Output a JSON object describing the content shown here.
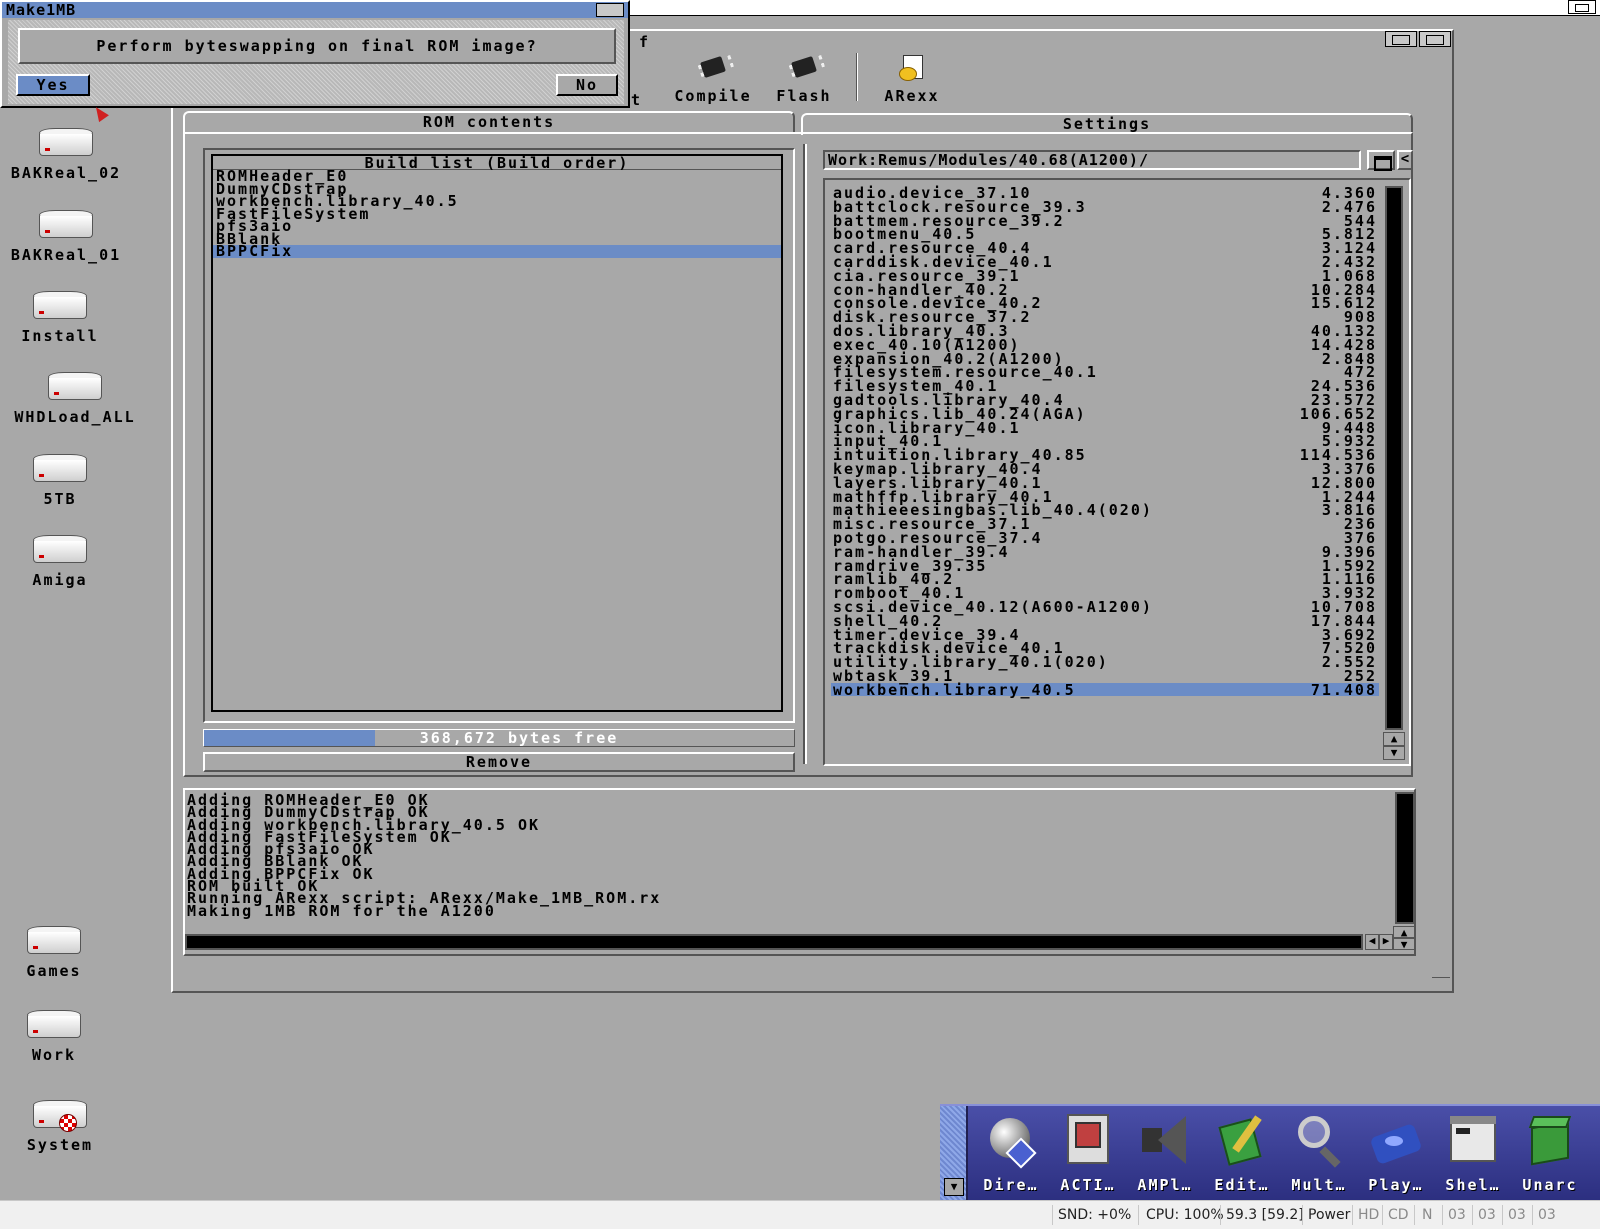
{
  "requester": {
    "title": "Make1MB",
    "message": "Perform byteswapping on final ROM image?",
    "yes_label": "Yes",
    "no_label": "No"
  },
  "desktop": {
    "icons": [
      {
        "label": "BAKReal_02",
        "icon": "harddisk-icon"
      },
      {
        "label": "BAKReal_01",
        "icon": "harddisk-icon"
      },
      {
        "label": "Install",
        "icon": "harddisk-icon"
      },
      {
        "label": "WHDLoad_ALL",
        "icon": "harddisk-icon"
      },
      {
        "label": "5TB",
        "icon": "harddisk-icon"
      },
      {
        "label": "Amiga",
        "icon": "harddisk-icon"
      },
      {
        "label": "Games",
        "icon": "harddisk-icon"
      },
      {
        "label": "Work",
        "icon": "harddisk-icon"
      },
      {
        "label": "System",
        "icon": "harddisk-icon"
      }
    ]
  },
  "window": {
    "title_fragment": "f",
    "toolbar": {
      "partial_label": "t",
      "compile_label": "Compile",
      "flash_label": "Flash",
      "arexx_label": "ARexx"
    },
    "tabs": {
      "rom_contents": "ROM contents",
      "settings": "Settings"
    },
    "build_list": {
      "header": "Build list (Build order)",
      "items": [
        "ROMHeader_E0",
        "DummyCDstrap",
        "workbench.library_40.5",
        "FastFileSystem",
        "pfs3aio",
        "BBlank",
        "BPPCFix"
      ],
      "selected_index": 6
    },
    "free_bar": {
      "label": "368,672 bytes free",
      "fill_fraction": 0.29
    },
    "remove_label": "Remove",
    "path": "Work:Remus/Modules/40.68(A1200)/",
    "back_label": "<",
    "modules": [
      {
        "name": "audio.device_37.10",
        "size": "4.360"
      },
      {
        "name": "battclock.resource_39.3",
        "size": "2.476"
      },
      {
        "name": "battmem.resource_39.2",
        "size": "544"
      },
      {
        "name": "bootmenu_40.5",
        "size": "5.812"
      },
      {
        "name": "card.resource_40.4",
        "size": "3.124"
      },
      {
        "name": "carddisk.device_40.1",
        "size": "2.432"
      },
      {
        "name": "cia.resource_39.1",
        "size": "1.068"
      },
      {
        "name": "con-handler_40.2",
        "size": "10.284"
      },
      {
        "name": "console.device_40.2",
        "size": "15.612"
      },
      {
        "name": "disk.resource_37.2",
        "size": "908"
      },
      {
        "name": "dos.library_40.3",
        "size": "40.132"
      },
      {
        "name": "exec_40.10(A1200)",
        "size": "14.428"
      },
      {
        "name": "expansion_40.2(A1200)",
        "size": "2.848"
      },
      {
        "name": "filesystem.resource_40.1",
        "size": "472"
      },
      {
        "name": "filesystem_40.1",
        "size": "24.536"
      },
      {
        "name": "gadtools.library_40.4",
        "size": "23.572"
      },
      {
        "name": "graphics.lib_40.24(AGA)",
        "size": "106.652"
      },
      {
        "name": "icon.library_40.1",
        "size": "9.448"
      },
      {
        "name": "input_40.1",
        "size": "5.932"
      },
      {
        "name": "intuition.library_40.85",
        "size": "114.536"
      },
      {
        "name": "keymap.library_40.4",
        "size": "3.376"
      },
      {
        "name": "layers.library_40.1",
        "size": "12.800"
      },
      {
        "name": "mathffp.library_40.1",
        "size": "1.244"
      },
      {
        "name": "mathieeesingbas.lib_40.4(020)",
        "size": "3.816"
      },
      {
        "name": "misc.resource_37.1",
        "size": "236"
      },
      {
        "name": "potgo.resource_37.4",
        "size": "376"
      },
      {
        "name": "ram-handler_39.4",
        "size": "9.396"
      },
      {
        "name": "ramdrive_39.35",
        "size": "1.592"
      },
      {
        "name": "ramlib_40.2",
        "size": "1.116"
      },
      {
        "name": "romboot_40.1",
        "size": "3.932"
      },
      {
        "name": "scsi.device_40.12(A600-A1200)",
        "size": "10.708"
      },
      {
        "name": "shell_40.2",
        "size": "17.844"
      },
      {
        "name": "timer.device_39.4",
        "size": "3.692"
      },
      {
        "name": "trackdisk.device_40.1",
        "size": "7.520"
      },
      {
        "name": "utility.library_40.1(020)",
        "size": "2.552"
      },
      {
        "name": "wbtask_39.1",
        "size": "252"
      },
      {
        "name": "workbench.library_40.5",
        "size": "71.408"
      }
    ],
    "selected_module_index": 36,
    "log": [
      {
        "text": "Adding ROMHeader_E0",
        "status": "OK"
      },
      {
        "text": "Adding DummyCDstrap",
        "status": "OK"
      },
      {
        "text": "Adding workbench.library_40.5",
        "status": "OK"
      },
      {
        "text": "Adding FastFileSystem",
        "status": "OK"
      },
      {
        "text": "Adding pfs3aio",
        "status": "OK"
      },
      {
        "text": "Adding BBlank",
        "status": "OK"
      },
      {
        "text": "Adding BPPCFix",
        "status": "OK"
      },
      {
        "text": "ROM built",
        "status": "OK"
      },
      {
        "text": "Running ARexx script: ARexx/Make_1MB_ROM.rx",
        "status": ""
      },
      {
        "text": "Making 1MB ROM for the A1200",
        "status": ""
      }
    ]
  },
  "dock": {
    "items": [
      {
        "label": "Dire…",
        "icon": "directory-opus-icon"
      },
      {
        "label": "ACTI…",
        "icon": "activity-icon"
      },
      {
        "label": "AMPl…",
        "icon": "speaker-icon"
      },
      {
        "label": "Edit…",
        "icon": "editor-pencil-icon"
      },
      {
        "label": "Mult…",
        "icon": "magnifier-icon"
      },
      {
        "label": "Play…",
        "icon": "player-disc-icon"
      },
      {
        "label": "Shel…",
        "icon": "shell-window-icon"
      },
      {
        "label": "Unarc",
        "icon": "archive-box-icon"
      }
    ]
  },
  "statusbar": {
    "snd": "SND: +0%",
    "cpu": "CPU: 100%",
    "fps": "59.3 [59.2]",
    "power": "Power",
    "hd": "HD",
    "cd": "CD",
    "n": "N",
    "slots": [
      "03",
      "03",
      "03",
      "03"
    ]
  },
  "colors": {
    "workbench_gray": "#a8a8a8",
    "selection_blue": "#6b8cc6",
    "dock_blue": "#3a3f98"
  }
}
